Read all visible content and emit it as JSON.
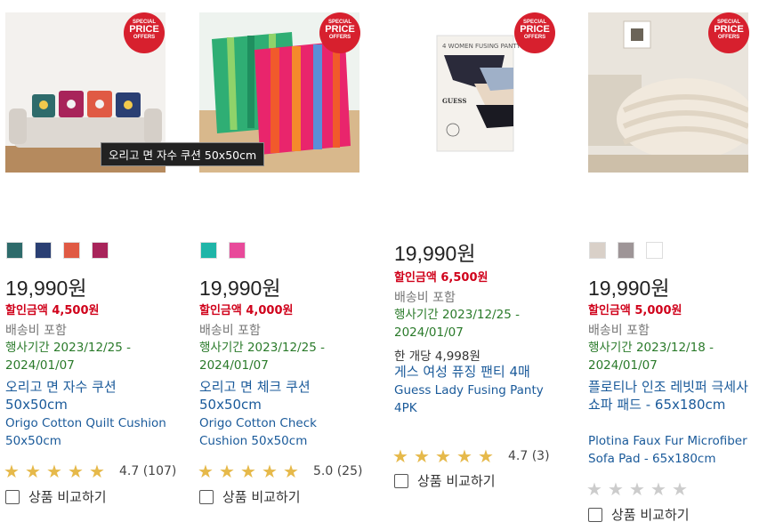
{
  "badge": {
    "line1": "SPECIAL",
    "line2": "PRICE",
    "line3": "OFFERS"
  },
  "tooltip": "오리고 면 자수 쿠션 50x50cm",
  "products": [
    {
      "swatches": [
        "#2e6b6b",
        "#2a3f73",
        "#e05a44",
        "#a8245a"
      ],
      "price": "19,990원",
      "discount": "할인금액 4,500원",
      "shipping": "배송비 포함",
      "period_line1": "행사기간 2023/12/25 -",
      "period_line2": "2024/01/07",
      "name_ko": "오리고 면 자수 쿠션 50x50cm",
      "name_en": "Origo Cotton Quilt Cushion 50x50cm",
      "rating": 5,
      "rating_text": "4.7 (107)",
      "compare": "상품 비교하기"
    },
    {
      "swatches": [
        "#1fb5a8",
        "#e84a9a"
      ],
      "price": "19,990원",
      "discount": "할인금액 4,000원",
      "shipping": "배송비 포함",
      "period_line1": "행사기간 2023/12/25 -",
      "period_line2": "2024/01/07",
      "name_ko": "오리고 면 체크 쿠션 50x50cm",
      "name_en": "Origo Cotton Check Cushion 50x50cm",
      "rating": 5,
      "rating_text": "5.0 (25)",
      "compare": "상품 비교하기"
    },
    {
      "swatches": [],
      "price": "19,990원",
      "discount": "할인금액 6,500원",
      "shipping": "배송비 포함",
      "period_line1": "행사기간 2023/12/25 -",
      "period_line2": "2024/01/07",
      "unit_price": "한 개당 4,998원",
      "name_ko": "게스 여성 퓨징 팬티 4매",
      "name_en": "Guess Lady Fusing Panty 4PK",
      "rating": 5,
      "rating_text": "4.7 (3)",
      "compare": "상품 비교하기",
      "pack_text": "4 WOMEN FUSING PANTY",
      "brand_text": "GUESS"
    },
    {
      "swatches": [
        "#d9d0c8",
        "#9e9597",
        "#ffffff"
      ],
      "price": "19,990원",
      "discount": "할인금액 5,000원",
      "shipping": "배송비 포함",
      "period_line1": "행사기간 2023/12/18 -",
      "period_line2": "2024/01/07",
      "name_ko": "플로티나 인조 레빗퍼 극세사 쇼파 패드 - 65x180cm",
      "name_en": "Plotina Faux Fur Microfiber Sofa Pad - 65x180cm",
      "rating": 0,
      "rating_text": "",
      "compare": "상품 비교하기"
    }
  ]
}
